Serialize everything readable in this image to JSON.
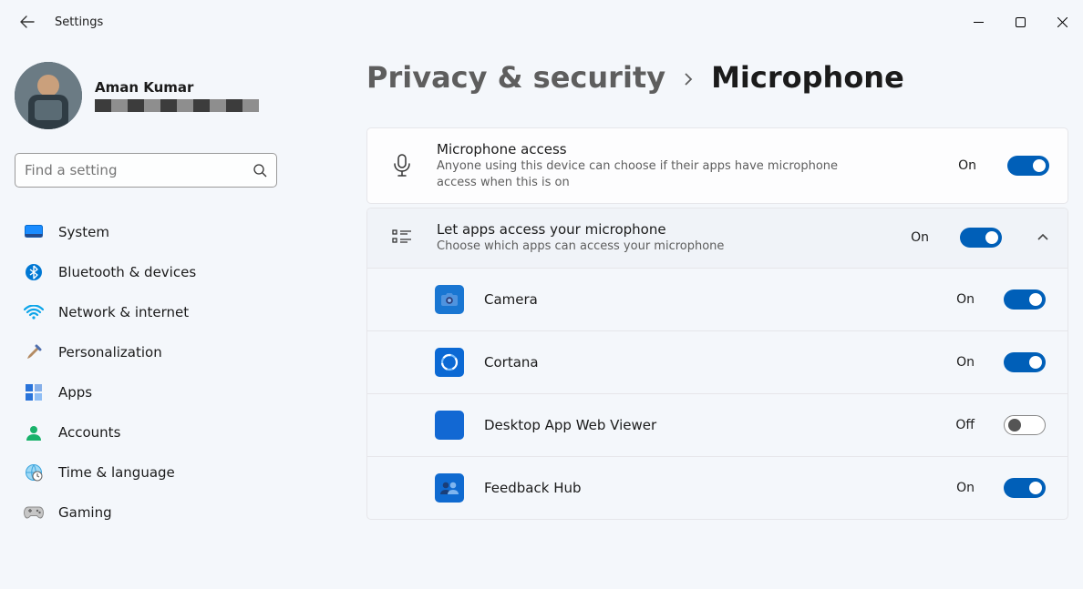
{
  "window": {
    "title": "Settings"
  },
  "user": {
    "name": "Aman Kumar"
  },
  "search": {
    "placeholder": "Find a setting"
  },
  "sidebar": {
    "items": [
      {
        "label": "System"
      },
      {
        "label": "Bluetooth & devices"
      },
      {
        "label": "Network & internet"
      },
      {
        "label": "Personalization"
      },
      {
        "label": "Apps"
      },
      {
        "label": "Accounts"
      },
      {
        "label": "Time & language"
      },
      {
        "label": "Gaming"
      }
    ]
  },
  "breadcrumb": {
    "parent": "Privacy & security",
    "current": "Microphone"
  },
  "main": {
    "access": {
      "title": "Microphone access",
      "sub": "Anyone using this device can choose if their apps have microphone access when this is on",
      "state": "On"
    },
    "apps": {
      "title": "Let apps access your microphone",
      "sub": "Choose which apps can access your microphone",
      "state": "On"
    },
    "list": [
      {
        "name": "Camera",
        "state": "On",
        "icon_bg": "#1976d2"
      },
      {
        "name": "Cortana",
        "state": "On",
        "icon_bg": "#0b69d4"
      },
      {
        "name": "Desktop App Web Viewer",
        "state": "Off",
        "icon_bg": "#1268d3"
      },
      {
        "name": "Feedback Hub",
        "state": "On",
        "icon_bg": "#0f6ad0"
      }
    ]
  }
}
